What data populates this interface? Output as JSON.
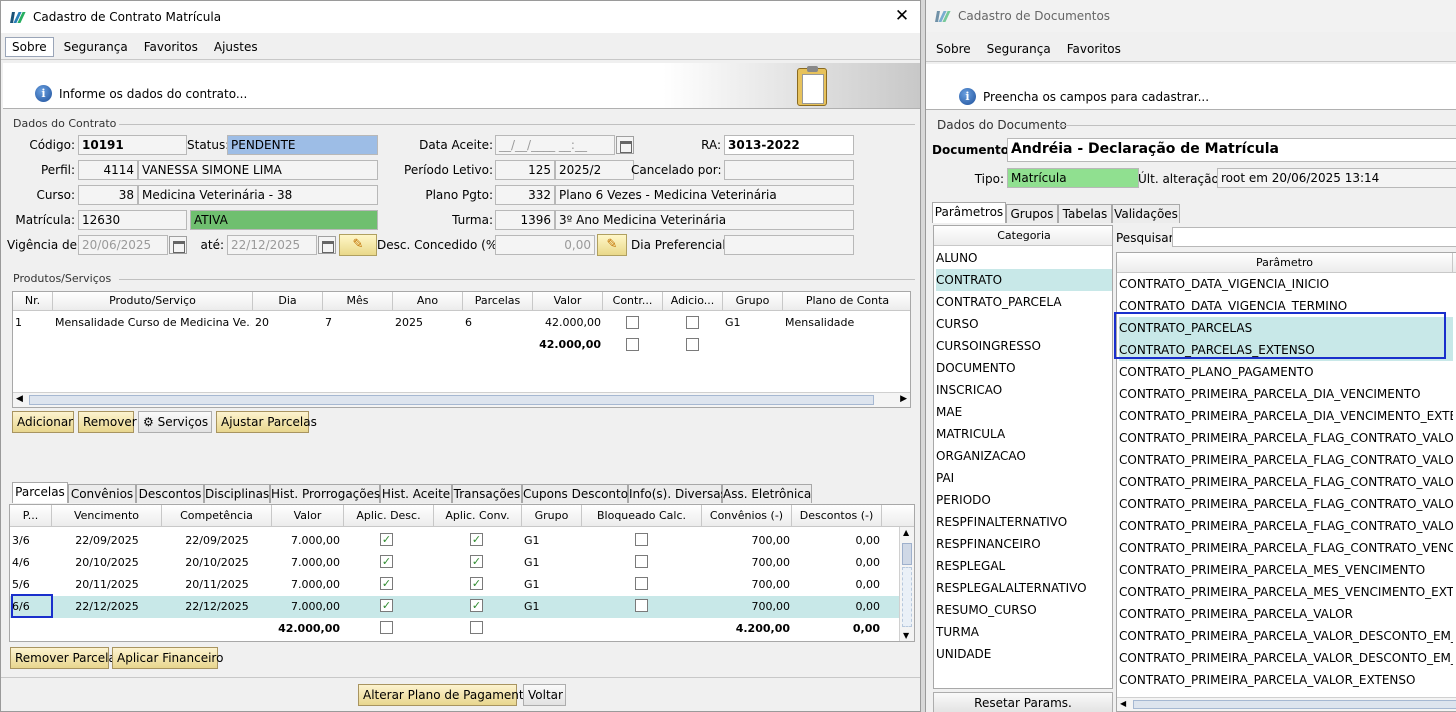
{
  "left": {
    "title": "Cadastro de Contrato Matrícula",
    "menu": [
      "Sobre",
      "Segurança",
      "Favoritos",
      "Ajustes"
    ],
    "banner": "Informe os dados do contrato...",
    "group_contrato": "Dados do Contrato",
    "codigo_label": "Código:",
    "codigo": "10191",
    "status_label": "Status:",
    "status": "PENDENTE",
    "data_aceite_label": "Data Aceite:",
    "data_aceite": "__/__/____ __:__",
    "ra_label": "RA:",
    "ra": "3013-2022",
    "perfil_label": "Perfil:",
    "perfil_id": "4114",
    "perfil_nome": "VANESSA SIMONE LIMA",
    "periodo_label": "Período Letivo:",
    "periodo_id": "125",
    "periodo": "2025/2",
    "cancelado_label": "Cancelado por:",
    "curso_label": "Curso:",
    "curso_id": "38",
    "curso": "Medicina Veterinária - 38",
    "plano_label": "Plano Pgto:",
    "plano_id": "332",
    "plano": "Plano 6 Vezes - Medicina Veterinária",
    "matricula_label": "Matrícula:",
    "matricula": "12630",
    "matricula_status": "ATIVA",
    "turma_label": "Turma:",
    "turma_id": "1396",
    "turma": "3º Ano Medicina Veterinária",
    "vigencia_label": "Vigência de:",
    "vig_de": "20/06/2025",
    "ate_label": "até:",
    "vig_ate": "22/12/2025",
    "desc_label": "Desc. Concedido (%):",
    "desc": "0,00",
    "dia_pref_label": "Dia Preferencial:",
    "group_produtos": "Produtos/Serviços",
    "prod_headers": [
      "Nr.",
      "Produto/Serviço",
      "Dia",
      "Mês",
      "Ano",
      "Parcelas",
      "Valor",
      "Contr...",
      "Adicio...",
      "Grupo",
      "Plano de Conta"
    ],
    "prod_row": {
      "nr": "1",
      "produto": "Mensalidade Curso de Medicina Ve...",
      "dia": "20",
      "mes": "7",
      "ano": "2025",
      "parcelas": "6",
      "valor": "42.000,00",
      "grupo": "G1",
      "conta": "Mensalidade"
    },
    "prod_total": "42.000,00",
    "buttons": {
      "adicionar": "Adicionar",
      "remover": "Remover",
      "servicos": "Serviços",
      "ajustar": "Ajustar Parcelas"
    },
    "tabs": [
      "Parcelas",
      "Convênios",
      "Descontos",
      "Disciplinas",
      "Hist. Prorrogações",
      "Hist. Aceite",
      "Transações",
      "Cupons Desconto",
      "Info(s). Diversas",
      "Ass. Eletrônica"
    ],
    "parc_headers": [
      "P...",
      "Vencimento",
      "Competência",
      "Valor",
      "Aplic. Desc.",
      "Aplic. Conv.",
      "Grupo",
      "Bloqueado Calc.",
      "Convênios (-)",
      "Descontos (-)"
    ],
    "parcelas": [
      {
        "p": "3/6",
        "venc": "22/09/2025",
        "comp": "22/09/2025",
        "valor": "7.000,00",
        "grupo": "G1",
        "conv": "700,00",
        "desc": "0,00"
      },
      {
        "p": "4/6",
        "venc": "20/10/2025",
        "comp": "20/10/2025",
        "valor": "7.000,00",
        "grupo": "G1",
        "conv": "700,00",
        "desc": "0,00"
      },
      {
        "p": "5/6",
        "venc": "20/11/2025",
        "comp": "20/11/2025",
        "valor": "7.000,00",
        "grupo": "G1",
        "conv": "700,00",
        "desc": "0,00"
      },
      {
        "p": "6/6",
        "venc": "22/12/2025",
        "comp": "22/12/2025",
        "valor": "7.000,00",
        "grupo": "G1",
        "conv": "700,00",
        "desc": "0,00"
      }
    ],
    "parc_total": {
      "valor": "42.000,00",
      "conv": "4.200,00",
      "desc": "0,00"
    },
    "btn_remover_parcela": "Remover Parcela",
    "btn_aplicar": "Aplicar Financeiro",
    "btn_alterar": "Alterar Plano de Pagamento",
    "btn_voltar": "Voltar"
  },
  "right": {
    "title": "Cadastro de Documentos",
    "menu": [
      "Sobre",
      "Segurança",
      "Favoritos"
    ],
    "banner": "Preencha os campos para cadastrar...",
    "group": "Dados do Documento",
    "documento_label": "Documento:",
    "documento": "Andréia - Declaração de Matrícula",
    "tipo_label": "Tipo:",
    "tipo": "Matrícula",
    "ult_label": "Últ. alteração:",
    "ult": "root em 20/06/2025 13:14",
    "tabs": [
      "Parâmetros",
      "Grupos",
      "Tabelas",
      "Validações"
    ],
    "cat_header": "Categoria",
    "categorias": [
      "ALUNO",
      "CONTRATO",
      "CONTRATO_PARCELA",
      "CURSO",
      "CURSOINGRESSO",
      "DOCUMENTO",
      "INSCRICAO",
      "MAE",
      "MATRICULA",
      "ORGANIZACAO",
      "PAI",
      "PERIODO",
      "RESPFINALTERNATIVO",
      "RESPFINANCEIRO",
      "RESPLEGAL",
      "RESPLEGALALTERNATIVO",
      "RESUMO_CURSO",
      "TURMA",
      "UNIDADE"
    ],
    "pesquisar_label": "Pesquisar:",
    "param_header": "Parâmetro",
    "parametros": [
      "CONTRATO_DATA_VIGENCIA_INICIO",
      "CONTRATO_DATA_VIGENCIA_TERMINO",
      "CONTRATO_PARCELAS",
      "CONTRATO_PARCELAS_EXTENSO",
      "CONTRATO_PLANO_PAGAMENTO",
      "CONTRATO_PRIMEIRA_PARCELA_DIA_VENCIMENTO",
      "CONTRATO_PRIMEIRA_PARCELA_DIA_VENCIMENTO_EXTENSO",
      "CONTRATO_PRIMEIRA_PARCELA_FLAG_CONTRATO_VALOR",
      "CONTRATO_PRIMEIRA_PARCELA_FLAG_CONTRATO_VALOR_...",
      "CONTRATO_PRIMEIRA_PARCELA_FLAG_CONTRATO_VALOR_...",
      "CONTRATO_PRIMEIRA_PARCELA_FLAG_CONTRATO_VALOR_...",
      "CONTRATO_PRIMEIRA_PARCELA_FLAG_CONTRATO_VALOR_...",
      "CONTRATO_PRIMEIRA_PARCELA_FLAG_CONTRATO_VENCIM...",
      "CONTRATO_PRIMEIRA_PARCELA_MES_VENCIMENTO",
      "CONTRATO_PRIMEIRA_PARCELA_MES_VENCIMENTO_EXTEN...",
      "CONTRATO_PRIMEIRA_PARCELA_VALOR",
      "CONTRATO_PRIMEIRA_PARCELA_VALOR_DESCONTO_EM_P...",
      "CONTRATO_PRIMEIRA_PARCELA_VALOR_DESCONTO_EM_P...",
      "CONTRATO_PRIMEIRA_PARCELA_VALOR_EXTENSO"
    ],
    "btn_resetar": "Resetar Params."
  },
  "colors": {
    "status_bg": "#9dbde6",
    "ativa_bg": "#6fbf6f",
    "tipo_bg": "#90e090",
    "sel_row": "#c8e8e8",
    "highlight": "#1a2fcc"
  }
}
